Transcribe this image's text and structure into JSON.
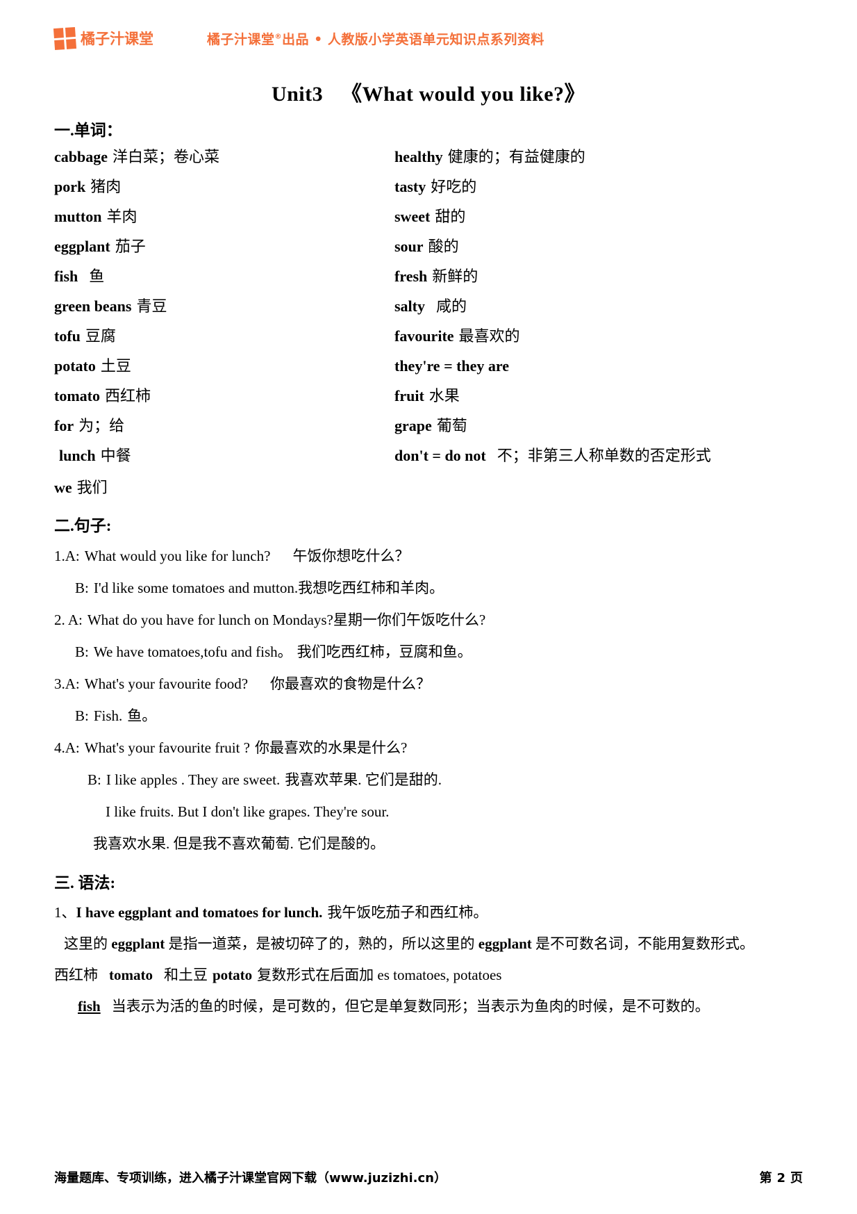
{
  "header": {
    "logo_text": "橘子汁课堂",
    "logo_color": "#f4703a",
    "tagline_prefix": "橘子汁课堂",
    "tagline_sup": "®",
    "tagline_suffix": "出品 • 人教版小学英语单元知识点系列资料"
  },
  "title": {
    "unit": "Unit3",
    "name": "《What would you like?》"
  },
  "sections": {
    "vocab_heading": "一.单词：",
    "sentence_heading": "二.句子:",
    "grammar_heading": "三. 语法:"
  },
  "vocab": {
    "left": [
      {
        "en": "cabbage",
        "zh": "洋白菜；卷心菜"
      },
      {
        "en": "pork",
        "zh": "猪肉"
      },
      {
        "en": "mutton",
        "zh": "羊肉"
      },
      {
        "en": "eggplant",
        "zh": "茄子"
      },
      {
        "en": "fish",
        "zh": "鱼"
      },
      {
        "en": "green beans",
        "zh": "青豆"
      },
      {
        "en": "tofu",
        "zh": "豆腐"
      },
      {
        "en": "potato",
        "zh": "土豆"
      },
      {
        "en": "tomato",
        "zh": "西红柿"
      },
      {
        "en": "for",
        "zh": "为；给"
      },
      {
        "en": "lunch",
        "zh": "中餐"
      }
    ],
    "right": [
      {
        "en": "healthy",
        "zh": "健康的；有益健康的"
      },
      {
        "en": "tasty",
        "zh": "好吃的"
      },
      {
        "en": "sweet",
        "zh": "甜的"
      },
      {
        "en": "sour",
        "zh": "酸的"
      },
      {
        "en": "fresh",
        "zh": "新鲜的"
      },
      {
        "en": "salty",
        "zh": "咸的"
      },
      {
        "en": "favourite",
        "zh": "最喜欢的"
      },
      {
        "en": "they're = they are",
        "zh": ""
      },
      {
        "en": "fruit",
        "zh": "水果"
      },
      {
        "en": "grape",
        "zh": "葡萄"
      },
      {
        "en": "don't = do not",
        "zh": "不；非第三人称单数的否定形式"
      }
    ],
    "last_left": {
      "en": "we",
      "zh": "我们"
    }
  },
  "sentences": [
    {
      "no": "1.A:",
      "en": "What would you like for lunch?",
      "zh": "午饭你想吃什么？"
    },
    {
      "no": "B:",
      "en": "I'd like some tomatoes and mutton.",
      "zh": "我想吃西红柿和羊肉。"
    },
    {
      "no": "2.  A:",
      "en": "What do you  have for lunch on Mondays?",
      "zh": "星期一你们午饭吃什么?"
    },
    {
      "no": "B:",
      "en": "We have tomatoes,tofu and fish。",
      "zh": "我们吃西红柿，豆腐和鱼。"
    },
    {
      "no": "3.A:",
      "en": "What's your favourite food?",
      "zh": "你最喜欢的食物是什么？"
    },
    {
      "no": "B:",
      "en": "Fish.",
      "zh": "鱼。"
    },
    {
      "no": "4.A:",
      "en": "What's your favourite fruit ?",
      "zh": "你最喜欢的水果是什么?"
    },
    {
      "no": "B:",
      "en": "I like apples  . They are sweet.",
      "zh": "我喜欢苹果. 它们是甜的."
    },
    {
      "no": "",
      "en": "I like fruits. But I don't like grapes. They're sour.",
      "zh": ""
    },
    {
      "no": "",
      "en": "",
      "zh": "我喜欢水果. 但是我不喜欢葡萄. 它们是酸的。"
    }
  ],
  "grammar": {
    "item1_num": "1、",
    "item1_en": "I have eggplant and tomatoes for lunch.",
    "item1_zh": "我午饭吃茄子和西红柿。",
    "note1_a": "这里的 ",
    "note1_w1": "eggplant",
    "note1_b": " 是指一道菜，是被切碎了的，熟的，所以这里的 ",
    "note1_w2": "eggplant",
    "note1_c": " 是不可数名词，不能用复数形式。",
    "line2_a": "西红柿",
    "line2_w1": "tomato",
    "line2_b": "和土豆",
    "line2_w2": "potato",
    "line2_c": "复数形式在后面加 es tomatoes, potatoes",
    "line3_w": "fish",
    "line3_text": "当表示为活的鱼的时候，是可数的，但它是单复数同形；当表示为鱼肉的时候，是不可数的。"
  },
  "footer": {
    "left": "海量题库、专项训练，进入橘子汁课堂官网下载（www.juzizhi.cn）",
    "right_prefix": "第",
    "right_page": "2",
    "right_suffix": "页"
  }
}
